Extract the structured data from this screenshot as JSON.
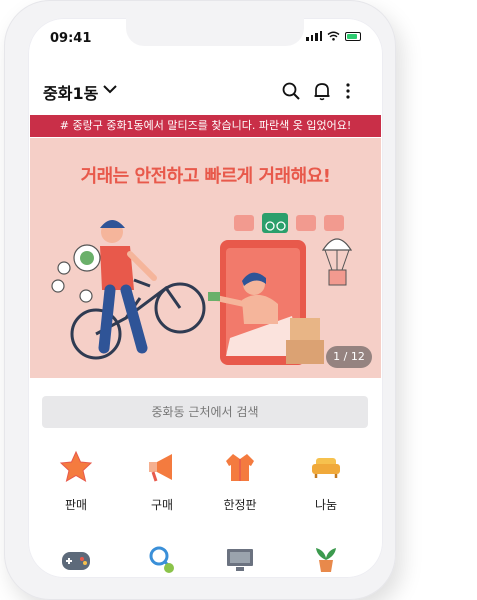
{
  "status": {
    "time": "09:41"
  },
  "header": {
    "location": "중화1동"
  },
  "notice": {
    "text": "# 중랑구 중화1동에서 말티즈를 찾습니다. 파란색 옷 입었어요!"
  },
  "banner": {
    "title": "거래는 안전하고 빠르게 거래해요!",
    "pager": "1 / 12"
  },
  "search": {
    "placeholder": "중화동 근처에서 검색"
  },
  "categories": [
    {
      "label": "판매",
      "icon": "star-icon"
    },
    {
      "label": "구매",
      "icon": "megaphone-icon"
    },
    {
      "label": "한정판",
      "icon": "jacket-icon"
    },
    {
      "label": "나눔",
      "icon": "sofa-icon"
    }
  ],
  "categories_row2": [
    {
      "icon": "gamepad-icon"
    },
    {
      "icon": "sports-icon"
    },
    {
      "icon": "monitor-icon"
    },
    {
      "icon": "plant-icon"
    }
  ],
  "colors": {
    "accent": "#c92f48",
    "banner_bg": "#f5cfc7",
    "title": "#e8594b"
  }
}
